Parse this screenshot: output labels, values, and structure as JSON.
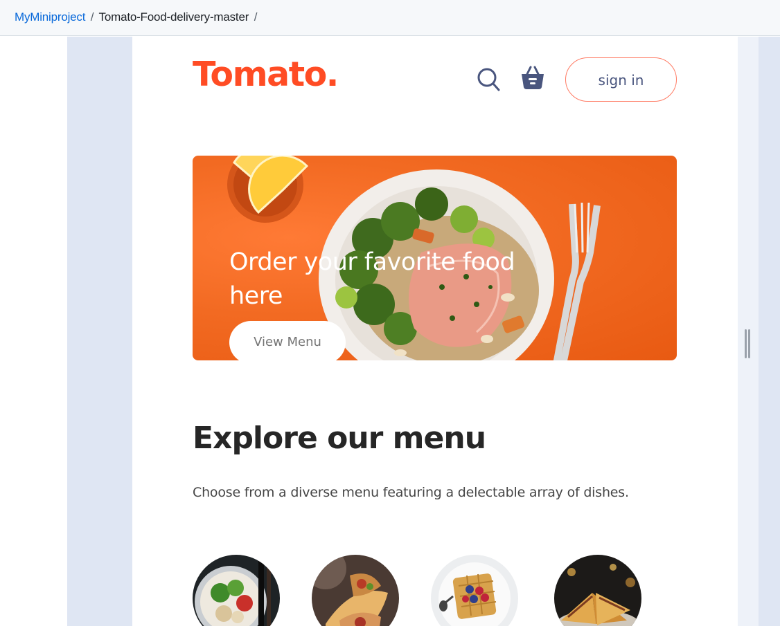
{
  "breadcrumb": {
    "repo_owner": "MyMiniproject",
    "separator": "/",
    "repo_name": "Tomato-Food-delivery-master",
    "trailing_separator": "/"
  },
  "navbar": {
    "logo": "Tomato.",
    "search_icon": "search-icon",
    "basket_icon": "basket-icon",
    "signin_label": "sign in"
  },
  "hero": {
    "title": "Order your favorite food here",
    "button_label": "View Menu"
  },
  "explore": {
    "title": "Explore our menu",
    "description": "Choose from a diverse menu featuring a delectable array of dishes."
  },
  "menu_items": [
    {
      "icon": "salad-bowl-image"
    },
    {
      "icon": "rolls-image"
    },
    {
      "icon": "waffle-dessert-image"
    },
    {
      "icon": "sandwich-image"
    }
  ],
  "colors": {
    "brand": "#ff4c24",
    "hero_orange": "#f26a22",
    "nav_text": "#49557e",
    "signin_border": "#ff7a63",
    "link": "#0969da"
  }
}
